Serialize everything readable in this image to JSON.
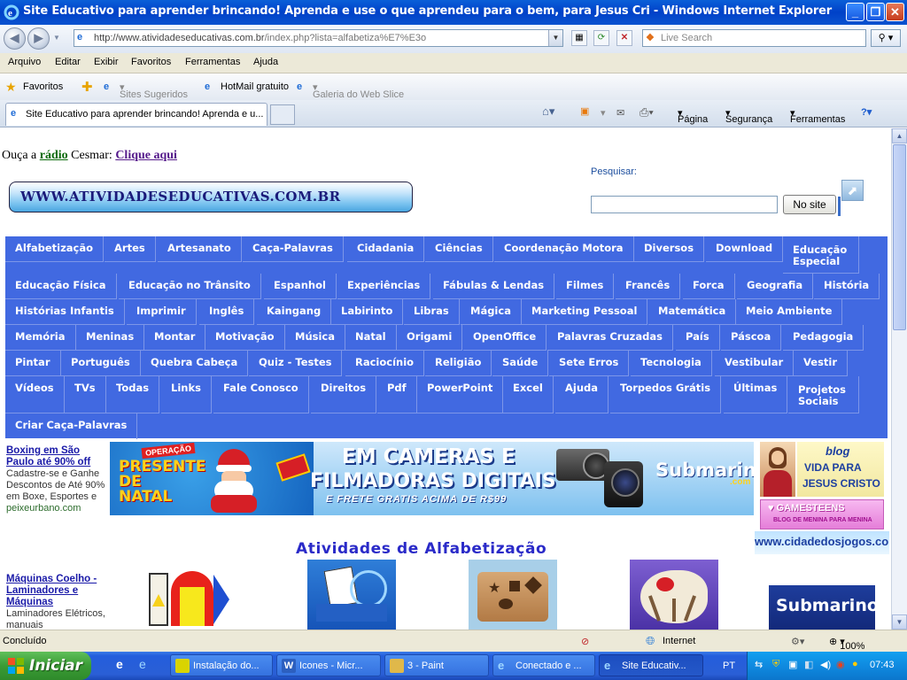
{
  "window": {
    "title": "Site Educativo para aprender brincando! Aprenda e use o que aprendeu para o bem, para Jesus Cri - Windows Internet Explorer"
  },
  "address": {
    "url_domain": "http://www.atividadeseducativas.com.br",
    "url_path": "/index.php?lista=alfabetiza%E7%E3o",
    "search_placeholder": "Live Search"
  },
  "menu": [
    "Arquivo",
    "Editar",
    "Exibir",
    "Favoritos",
    "Ferramentas",
    "Ajuda"
  ],
  "favbar": {
    "favorites": "Favoritos",
    "items": [
      "Sites Sugeridos",
      "HotMail gratuito",
      "Galeria do Web Slice"
    ]
  },
  "tab": {
    "title": "Site Educativo para aprender brincando! Aprenda e u..."
  },
  "cmdbar": {
    "page": "Página",
    "security": "Segurança",
    "tools": "Ferramentas"
  },
  "page": {
    "radio_prefix": "Ouça a",
    "radio_link": "rádio",
    "radio_middle": "Cesmar:",
    "radio_click": "Clique aqui",
    "site_banner": "WWW.ATIVIDADESEDUCATIVAS.COM.BR",
    "search_label": "Pesquisar:",
    "search_button": "No site",
    "section_title": "Atividades de Alfabetização"
  },
  "nav_items": [
    "Alfabetização",
    "Artes",
    "Artesanato",
    "Caça-Palavras",
    "Cidadania",
    "Ciências",
    "Coordenação Motora",
    "Diversos",
    "Download",
    "Educação Especial",
    "Educação Física",
    "Educação no Trânsito",
    "Espanhol",
    "Experiências",
    "Fábulas & Lendas",
    "Filmes",
    "Francês",
    "Forca",
    "Geografia",
    "História",
    "Histórias Infantis",
    "Imprimir",
    "Inglês",
    "Kaingang",
    "Labirinto",
    "Libras",
    "Mágica",
    "Marketing Pessoal",
    "Matemática",
    "Meio Ambiente",
    "Memória",
    "Meninas",
    "Montar",
    "Motivação",
    "Música",
    "Natal",
    "Origami",
    "OpenOffice",
    "Palavras Cruzadas",
    "País",
    "Páscoa",
    "Pedagogia",
    "Pintar",
    "Português",
    "Quebra Cabeça",
    "Quiz - Testes",
    "Raciocínio",
    "Religião",
    "Saúde",
    "Sete Erros",
    "Tecnologia",
    "Vestibular",
    "Vestir",
    "Vídeos",
    "TVs",
    "Todas",
    "Links",
    "Fale Conosco",
    "Direitos",
    "Pdf",
    "PowerPoint",
    "Excel",
    "Ajuda",
    "Torpedos Grátis",
    "Últimas",
    "Projetos Sociais",
    "Criar Caça-Palavras"
  ],
  "ads": [
    {
      "title": "Boxing em São Paulo até 90% off",
      "text": "Cadastre-se e Ganhe Descontos de Até 90% em Boxe, Esportes e",
      "url": "peixeurbano.com"
    },
    {
      "title": "Máquinas Coelho - Laminadores e Máquinas",
      "text": "Laminadores Elétricos, manuais",
      "url": ""
    }
  ],
  "banner": {
    "left_top": "OPERAÇÃO",
    "left_big": "PRESENTE DE NATAL",
    "line1": "EM CAMERAS E",
    "line2": "FILMADORAS DIGITAIS",
    "line3": "E FRETE GRATIS ACIMA DE R$99",
    "brand": "Submarino",
    "brand_sub": ".com"
  },
  "side_banners": {
    "blog_title": "blog",
    "blog_line1": "VIDA PARA",
    "blog_line2": "JESUS CRISTO",
    "gamesteens": "GAMESTEENS",
    "gamesteens_sub": "BLOG DE MENINA PARA MENINA",
    "cidade": "www.cidadedosjogos.com.br",
    "submarino": "Submarino"
  },
  "status": {
    "left": "Concluído",
    "zone": "Internet",
    "zoom": "100%"
  },
  "taskbar": {
    "start": "Iniciar",
    "tasks": [
      "Instalação do...",
      "Icones - Micr...",
      "3 - Paint",
      "Conectado e ...",
      "Site Educativ..."
    ],
    "lang": "PT",
    "clock": "07:43"
  },
  "colors": {
    "nav_bg": "#4169e1",
    "title_blue": "#0041c8",
    "section_title": "#2a2ac8"
  }
}
